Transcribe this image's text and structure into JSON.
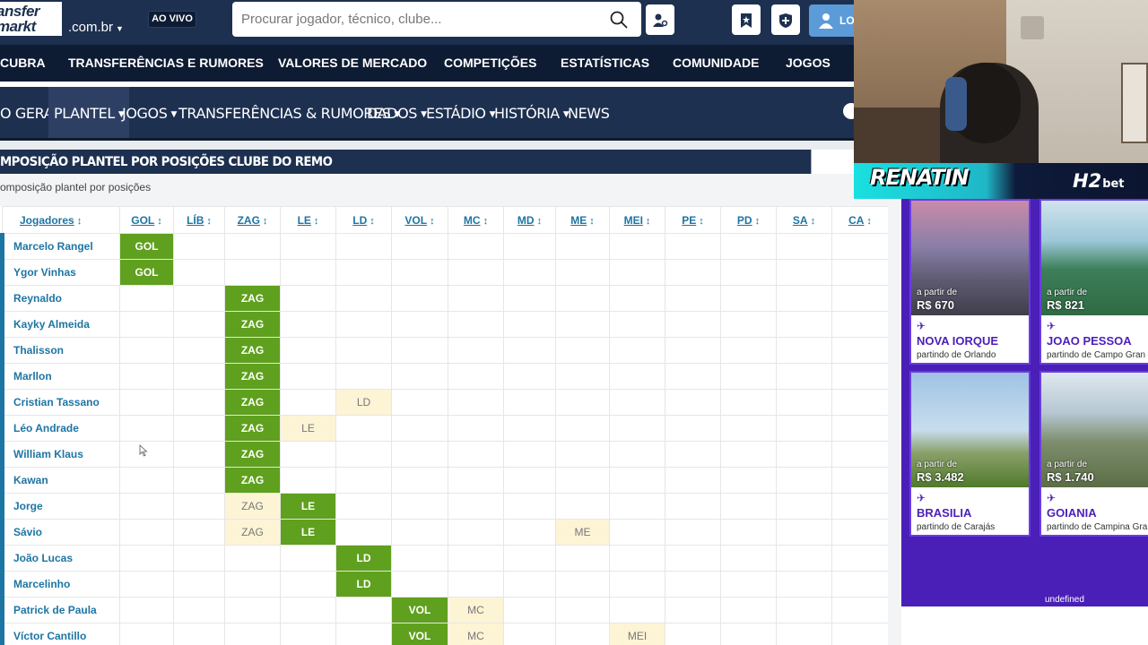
{
  "header": {
    "logo_line1": "ansfer",
    "logo_line2": "markt",
    "domain": ".com.br",
    "live_badge": "AO VIVO",
    "search_placeholder": "Procurar jogador, técnico, clube...",
    "login_label": "LO"
  },
  "main_nav": [
    "CUBRA",
    "TRANSFERÊNCIAS E RUMORES",
    "VALORES DE MERCADO",
    "COMPETIÇÕES",
    "ESTATÍSTICAS",
    "COMUNIDADE",
    "JOGOS"
  ],
  "club_nav": [
    {
      "label": "O GERAL",
      "caret": false,
      "active": false
    },
    {
      "label": "PLANTEL",
      "caret": true,
      "active": true
    },
    {
      "label": "JOGOS",
      "caret": true,
      "active": false
    },
    {
      "label": "TRANSFERÊNCIAS & RUMORES",
      "caret": true,
      "active": false
    },
    {
      "label": "DADOS",
      "caret": true,
      "active": false
    },
    {
      "label": "ESTÁDIO",
      "caret": true,
      "active": false
    },
    {
      "label": "HISTÓRIA",
      "caret": true,
      "active": false
    },
    {
      "label": "NEWS",
      "caret": false,
      "active": false
    }
  ],
  "box_title": "MPOSIÇÃO PLANTEL POR POSIÇÕES CLUBE DO REMO",
  "box_subtitle": "omposição plantel por posições",
  "table": {
    "columns": [
      "Jogadores",
      "GOL",
      "LÍB",
      "ZAG",
      "LE",
      "LD",
      "VOL",
      "MC",
      "MD",
      "ME",
      "MEI",
      "PE",
      "PD",
      "SA",
      "CA"
    ],
    "rows": [
      {
        "name": "Marcelo Rangel",
        "pri": [
          "GOL"
        ],
        "sec": []
      },
      {
        "name": "Ygor Vinhas",
        "pri": [
          "GOL"
        ],
        "sec": []
      },
      {
        "name": "Reynaldo",
        "pri": [
          "ZAG"
        ],
        "sec": []
      },
      {
        "name": "Kayky Almeida",
        "pri": [
          "ZAG"
        ],
        "sec": []
      },
      {
        "name": "Thalisson",
        "pri": [
          "ZAG"
        ],
        "sec": []
      },
      {
        "name": "Marllon",
        "pri": [
          "ZAG"
        ],
        "sec": []
      },
      {
        "name": "Cristian Tassano",
        "pri": [
          "ZAG"
        ],
        "sec": [
          "LD"
        ]
      },
      {
        "name": "Léo Andrade",
        "pri": [
          "ZAG"
        ],
        "sec": [
          "LE"
        ]
      },
      {
        "name": "William Klaus",
        "pri": [
          "ZAG"
        ],
        "sec": []
      },
      {
        "name": "Kawan",
        "pri": [
          "ZAG"
        ],
        "sec": []
      },
      {
        "name": "Jorge",
        "pri": [
          "LE"
        ],
        "sec": [
          "ZAG"
        ]
      },
      {
        "name": "Sávio",
        "pri": [
          "LE"
        ],
        "sec": [
          "ZAG",
          "ME"
        ]
      },
      {
        "name": "João Lucas",
        "pri": [
          "LD"
        ],
        "sec": []
      },
      {
        "name": "Marcelinho",
        "pri": [
          "LD"
        ],
        "sec": []
      },
      {
        "name": "Patrick de Paula",
        "pri": [
          "VOL"
        ],
        "sec": [
          "MC"
        ]
      },
      {
        "name": "Víctor Cantillo",
        "pri": [
          "VOL"
        ],
        "sec": [
          "MC",
          "MEI"
        ]
      }
    ]
  },
  "stream": {
    "streamer_name": "RENATIN",
    "sponsor": "H2",
    "sponsor_suffix": "bet"
  },
  "ads": {
    "cards": [
      {
        "from": "a partir de",
        "price": "R$ 670",
        "city": "NOVA IORQUE",
        "origin": "partindo de Orlando",
        "photo": "city"
      },
      {
        "from": "a partir de",
        "price": "R$ 821",
        "city": "JOAO PESSOA",
        "origin": "partindo de Campo Gran",
        "photo": "beach"
      },
      {
        "from": "a partir de",
        "price": "R$ 3.482",
        "city": "BRASILIA",
        "origin": "partindo de Carajás",
        "photo": "congress"
      },
      {
        "from": "a partir de",
        "price": "R$ 1.740",
        "city": "GOIANIA",
        "origin": "partindo de Campina Gra",
        "photo": "town"
      }
    ],
    "footer": "undefined"
  },
  "colors": {
    "primary_cell": "#5fa01e",
    "secondary_cell": "#fdf4d6",
    "link": "#1d75a3",
    "header": "#1d3050",
    "ad_purple": "#4a1fb8"
  }
}
